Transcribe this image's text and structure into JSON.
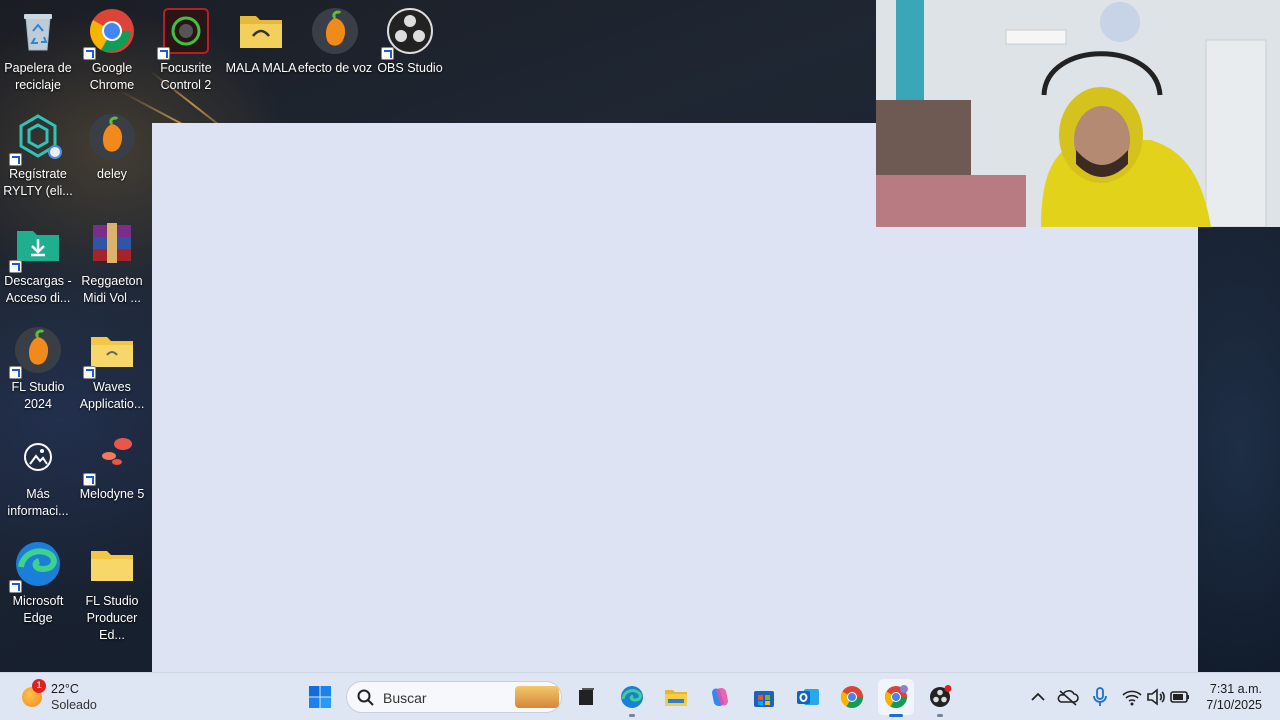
{
  "desktop": {
    "icons": [
      {
        "label": "Papelera de reciclaje",
        "icon": "recycle-bin-icon"
      },
      {
        "label": "Google Chrome",
        "icon": "chrome-icon"
      },
      {
        "label": "Focusrite Control 2",
        "icon": "focusrite-icon"
      },
      {
        "label": "MALA MALA",
        "icon": "folder-icon"
      },
      {
        "label": "efecto de voz",
        "icon": "fl-studio-icon"
      },
      {
        "label": "OBS Studio",
        "icon": "obs-icon"
      },
      {
        "label": "Regístrate RYLTY (eli...",
        "icon": "rylty-icon"
      },
      {
        "label": "deley",
        "icon": "fl-studio-icon"
      },
      {
        "label": "Descargas - Acceso di...",
        "icon": "downloads-folder-icon"
      },
      {
        "label": "Reggaeton Midi Vol ...",
        "icon": "winrar-icon"
      },
      {
        "label": "FL Studio 2024",
        "icon": "fl-studio-icon"
      },
      {
        "label": "Waves Applicatio...",
        "icon": "folder-icon"
      },
      {
        "label": "Más informaci...",
        "icon": "info-icon"
      },
      {
        "label": "Melodyne 5",
        "icon": "melodyne-icon"
      },
      {
        "label": "Microsoft Edge",
        "icon": "edge-icon"
      },
      {
        "label": "FL Studio Producer Ed...",
        "icon": "folder-icon"
      }
    ]
  },
  "taskbar": {
    "weather": {
      "temp": "22°C",
      "condition": "Soleado",
      "badge": "1"
    },
    "search_placeholder": "Buscar",
    "apps": [
      "start-icon",
      "task-view-icon",
      "edge-icon",
      "file-explorer-icon",
      "copilot-icon",
      "store-icon",
      "outlook-icon",
      "chrome-icon",
      "chrome-profile-icon",
      "obs-icon"
    ],
    "tray": [
      "chevron-up-icon",
      "onedrive-icon",
      "microphone-icon",
      "wifi-icon",
      "speaker-icon",
      "battery-icon"
    ],
    "time": "7:31 a.m.",
    "date": "7/10/2025"
  },
  "colors": {
    "panel": "#dde3f3",
    "taskbar": "#dfe6f3",
    "accent": "#1b6fd1"
  }
}
